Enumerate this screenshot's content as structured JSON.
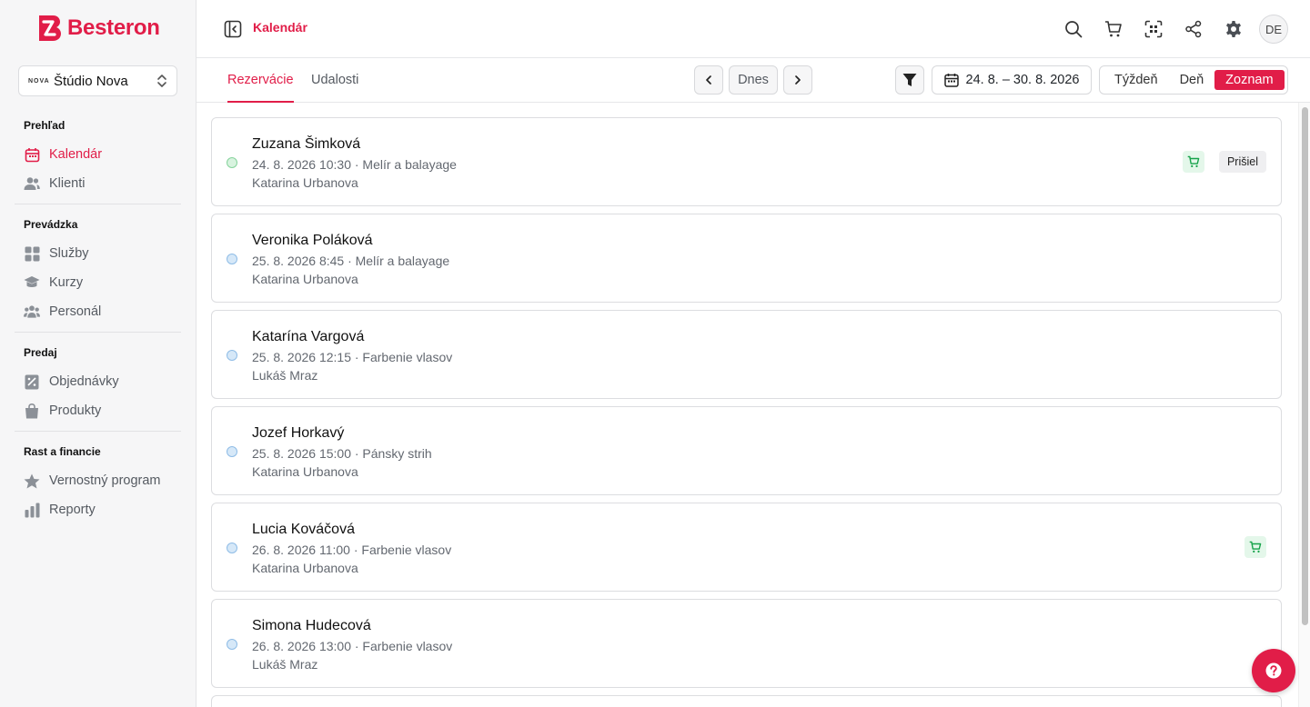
{
  "brand": {
    "name": "Besteron",
    "accent": "#e11d48"
  },
  "studio": {
    "name": "Štúdio Nova",
    "logo_text": "NOVA"
  },
  "sidebar": {
    "sections": [
      {
        "title": "Prehľad",
        "items": [
          {
            "label": "Kalendár",
            "icon": "calendar-icon",
            "active": true
          },
          {
            "label": "Klienti",
            "icon": "users-icon"
          }
        ]
      },
      {
        "title": "Prevádzka",
        "items": [
          {
            "label": "Služby",
            "icon": "grid-icon"
          },
          {
            "label": "Kurzy",
            "icon": "graduation-cap-icon"
          },
          {
            "label": "Personál",
            "icon": "team-icon"
          }
        ]
      },
      {
        "title": "Predaj",
        "items": [
          {
            "label": "Objednávky",
            "icon": "receipt-icon"
          },
          {
            "label": "Produkty",
            "icon": "bag-icon"
          }
        ]
      },
      {
        "title": "Rast a financie",
        "items": [
          {
            "label": "Vernostný program",
            "icon": "star-icon"
          },
          {
            "label": "Reporty",
            "icon": "bar-chart-icon"
          }
        ]
      }
    ]
  },
  "header": {
    "title": "Kalendár",
    "avatar_initials": "DE"
  },
  "toolbar": {
    "tabs": [
      "Rezervácie",
      "Udalosti"
    ],
    "today_label": "Dnes",
    "date_range": "24. 8. – 30. 8. 2026",
    "views": [
      "Týždeň",
      "Deň",
      "Zoznam"
    ],
    "active_view": "Zoznam"
  },
  "reservations": [
    {
      "client": "Zuzana Šimková",
      "detail": "24. 8. 2026 10:30 · Melír a balayage",
      "staff": "Katarina Urbanova",
      "dot": "green",
      "cart": true,
      "status": "Prišiel"
    },
    {
      "client": "Veronika Poláková",
      "detail": "25. 8. 2026 8:45 · Melír a balayage",
      "staff": "Katarina Urbanova",
      "dot": "blue",
      "cart": false,
      "status": ""
    },
    {
      "client": "Katarína Vargová",
      "detail": "25. 8. 2026 12:15 · Farbenie vlasov",
      "staff": "Lukáš Mraz",
      "dot": "blue",
      "cart": false,
      "status": ""
    },
    {
      "client": "Jozef Horkavý",
      "detail": "25. 8. 2026 15:00 · Pánsky strih",
      "staff": "Katarina Urbanova",
      "dot": "blue",
      "cart": false,
      "status": ""
    },
    {
      "client": "Lucia Kováčová",
      "detail": "26. 8. 2026 11:00 · Farbenie vlasov",
      "staff": "Katarina Urbanova",
      "dot": "blue",
      "cart": true,
      "status": ""
    },
    {
      "client": "Simona Hudecová",
      "detail": "26. 8. 2026 13:00 · Farbenie vlasov",
      "staff": "Lukáš Mraz",
      "dot": "blue",
      "cart": false,
      "status": ""
    }
  ]
}
